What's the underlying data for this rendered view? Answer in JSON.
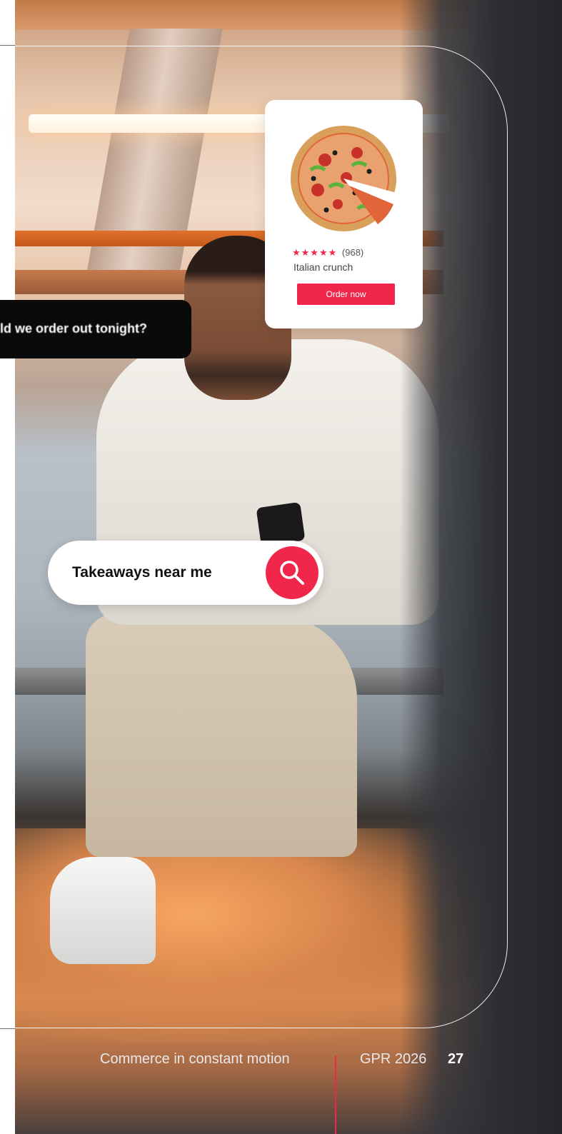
{
  "chat": {
    "text": "ld we order out tonight?"
  },
  "product_card": {
    "stars": "★★★★★",
    "rating": 4.5,
    "reviews": "(968)",
    "name": "Italian crunch",
    "order_label": "Order now",
    "image": "pizza"
  },
  "search": {
    "query": "Takeaways near me",
    "icon": "search-icon"
  },
  "footer": {
    "section_title": "Commerce in constant motion",
    "report": "GPR 2026",
    "page_number": "27"
  },
  "colors": {
    "accent": "#f0264a",
    "card": "#ffffff",
    "chat_bubble": "#0a0a0a"
  }
}
